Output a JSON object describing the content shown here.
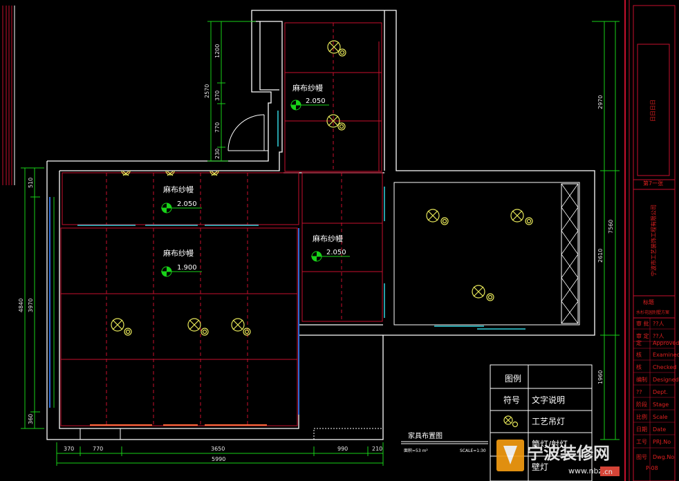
{
  "colors": {
    "background": "#000000",
    "wall": "#ffffff",
    "grid": "#c8102e",
    "dimension": "#19d219",
    "lamp": "#e8e85a",
    "curtain_rail": "#33d6e0",
    "title_block": "#c8102e"
  },
  "rooms": [
    {
      "label": "麻布纱幔",
      "elevation": "2.050"
    },
    {
      "label": "麻布纱幔",
      "elevation": "2.050"
    },
    {
      "label": "麻布纱幔",
      "elevation": "1.900"
    },
    {
      "label": "麻布纱幔",
      "elevation": "2.050"
    }
  ],
  "dimensions": {
    "bottom": [
      "370",
      "770",
      "3650",
      "990",
      "210",
      "5990"
    ],
    "left": [
      "4840",
      "3970",
      "510",
      "360"
    ],
    "top_left": [
      "2570",
      "1200",
      "370",
      "770",
      "230"
    ],
    "right": [
      "2970",
      "7560",
      "2610",
      "1960"
    ]
  },
  "drawing": {
    "title": "家具布置图",
    "area_note": "面积=53 m²",
    "scale": "SCALE=1:30"
  },
  "legend": {
    "header": "图例",
    "col_symbol": "符号",
    "col_text": "文字说明",
    "row1": "工艺吊灯",
    "row2_partial": "筒灯/射灯",
    "row3_partial": "壁灯"
  },
  "title_block": {
    "top_box": "日日日日",
    "subtitle": "第7一张",
    "company": "宁波市工艺装饰工程有限公司",
    "project_title": "标题",
    "project_name": "水杉花园别墅方案",
    "rows": [
      {
        "zh": "审 批",
        "en": "??人"
      },
      {
        "zh": "审 定",
        "en": "??人"
      },
      {
        "zh": "定",
        "en": "Approved"
      },
      {
        "zh": "核",
        "en": "Examined"
      },
      {
        "zh": "核",
        "en": "Checked"
      },
      {
        "zh": "编制",
        "en": "Designed"
      },
      {
        "zh": "??",
        "en": "Dept."
      },
      {
        "zh": "阶段",
        "en": "Stage"
      },
      {
        "zh": "比例",
        "en": "Scale"
      },
      {
        "zh": "日期",
        "en": "Date"
      },
      {
        "zh": "工号",
        "en": "PRJ.No"
      },
      {
        "zh": "图号",
        "en": "Dwg.No"
      }
    ],
    "sheet": "P-08"
  },
  "watermark": {
    "text": "宁波装修网",
    "domain": "www.nbzxw",
    "tld": ".cn"
  }
}
